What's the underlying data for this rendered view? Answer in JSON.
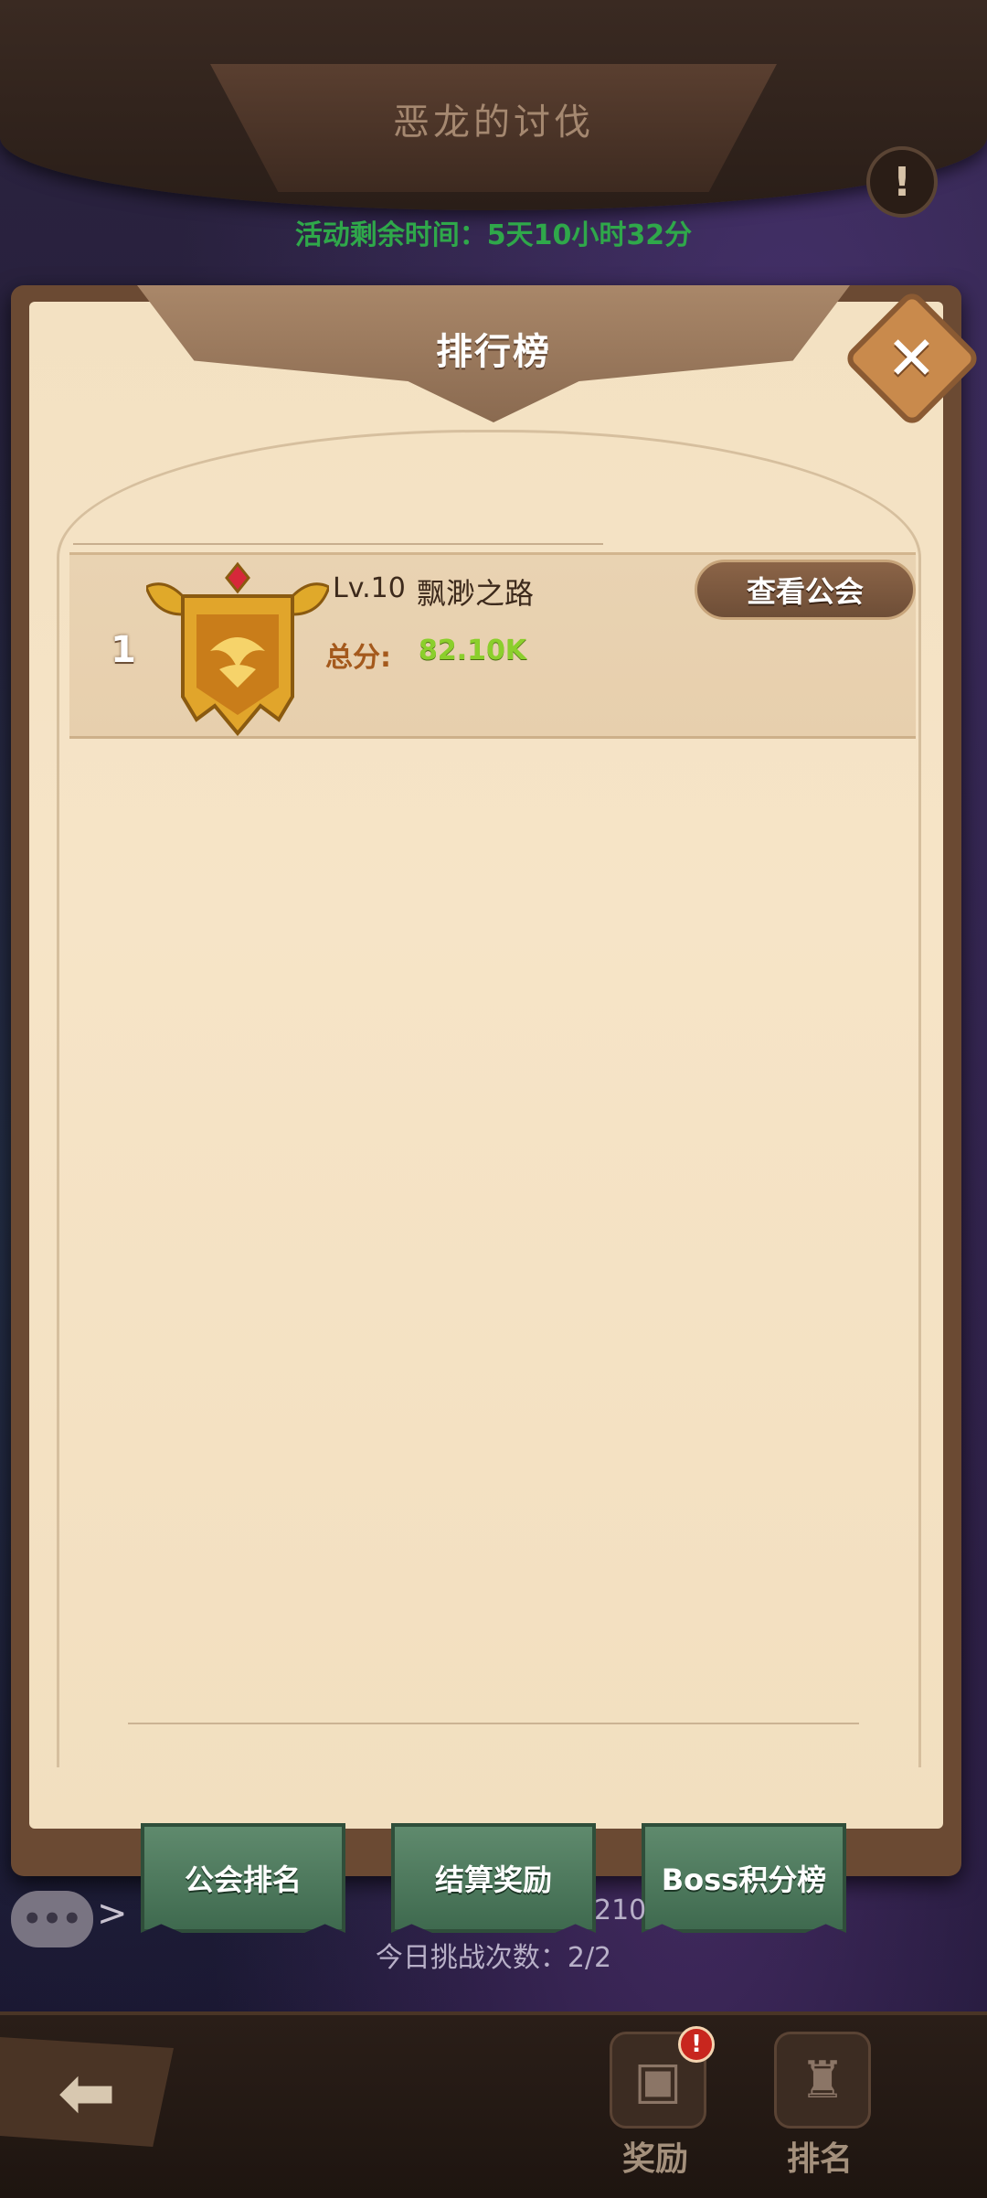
{
  "header": {
    "title": "恶龙的讨伐",
    "alert_icon": "!",
    "timer_text": "活动剩余时间：5天10小时32分"
  },
  "panel": {
    "title": "排行榜",
    "close_icon": "✕",
    "rows": [
      {
        "rank": "1",
        "level": "Lv.10",
        "guild_name": "飘渺之路",
        "score_label": "总分:",
        "score_value": "82.10K",
        "view_button": "查看公会"
      }
    ]
  },
  "tabs": [
    {
      "label": "公会排名"
    },
    {
      "label": "结算奖励"
    },
    {
      "label": "Boss积分榜"
    }
  ],
  "stats": {
    "partial_value": "210",
    "challenge_text": "今日挑战次数：2/2"
  },
  "chat": {
    "icon": "•••",
    "arrow": ">"
  },
  "nav": {
    "back_icon": "⬅",
    "items": [
      {
        "label": "奖励",
        "icon": "chest-icon",
        "badge": "!"
      },
      {
        "label": "排名",
        "icon": "ranking-icon"
      }
    ]
  },
  "colors": {
    "timer_green": "#2fa84a",
    "score_green": "#8bcf2c",
    "tab_green": "#4f7a5d",
    "paper": "#f3e1c2"
  }
}
